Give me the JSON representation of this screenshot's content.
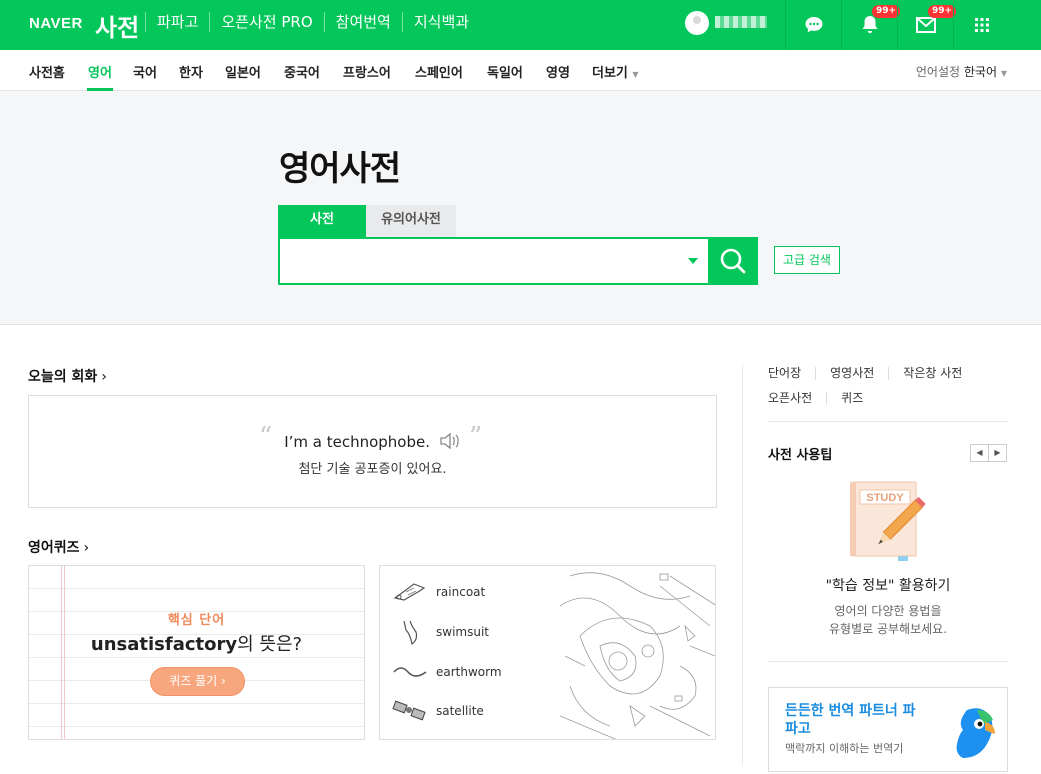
{
  "header": {
    "logo": "NAVER",
    "service": "사전",
    "nav": [
      "파파고",
      "오픈사전 PRO",
      "참여번역",
      "지식백과"
    ],
    "notifications_badge": "99+",
    "mail_badge": "99+"
  },
  "subnav": {
    "items": [
      "사전홈",
      "영어",
      "국어",
      "한자",
      "일본어",
      "중국어",
      "프랑스어",
      "스페인어",
      "독일어",
      "영영",
      "더보기"
    ],
    "active": "영어",
    "language_label": "언어설정",
    "language_value": "한국어"
  },
  "hero": {
    "title": "영어사전",
    "tabs": [
      "사전",
      "유의어사전"
    ],
    "search_value": "",
    "advanced_search": "고급 검색"
  },
  "conversation": {
    "title": "오늘의 회화",
    "english": "I’m a technophobe.",
    "korean": "첨단 기술 공포증이 있어요."
  },
  "quiz": {
    "title": "영어퀴즈",
    "tag": "핵심 단어",
    "word": "unsatisfactory",
    "question_suffix": "의 뜻은?",
    "button": "퀴즈 풀기"
  },
  "word_picture": {
    "words": [
      "raincoat",
      "swimsuit",
      "earthworm",
      "satellite"
    ]
  },
  "sidebar": {
    "links_row1": [
      "단어장",
      "영영사전",
      "작은창 사전"
    ],
    "links_row2": [
      "오픈사전",
      "퀴즈"
    ],
    "tip_title": "사전 사용팁",
    "tip_image_text": "STUDY",
    "tip_heading": "\"학습 정보\" 활용하기",
    "tip_line1": "영어의 다양한 용법을",
    "tip_line2": "유형별로 공부해보세요.",
    "promo_title": "든든한 번역 파트너 파파고",
    "promo_sub": "맥락까지 이해하는 번역기"
  },
  "colors": {
    "brand": "#03c75a",
    "quiz_accent": "#f08a5a",
    "promo": "#1a8ce0"
  }
}
